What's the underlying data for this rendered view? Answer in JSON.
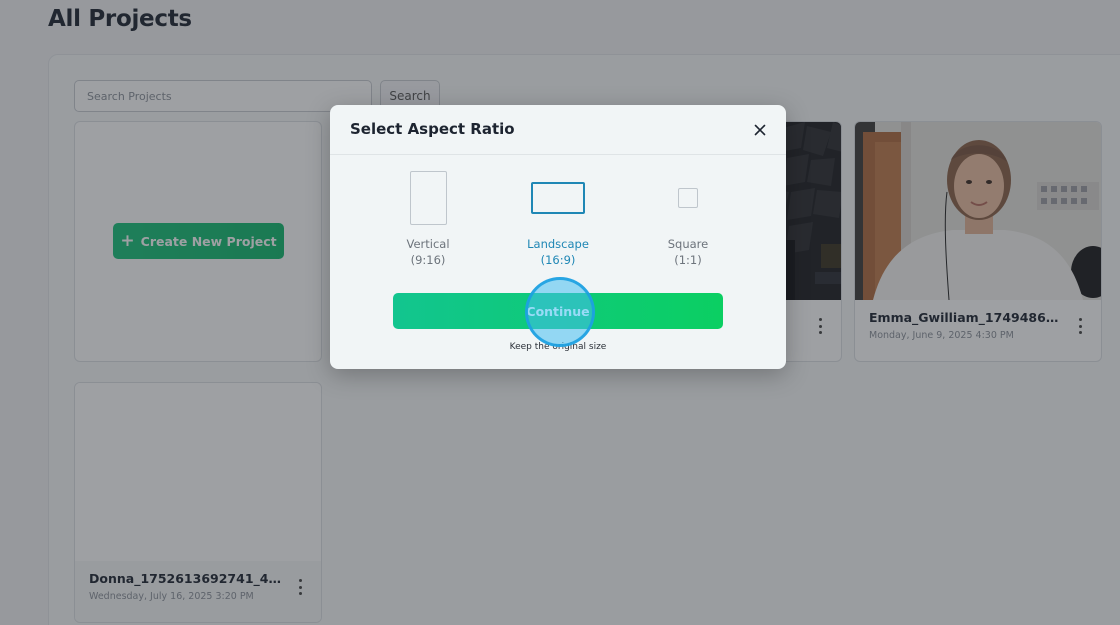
{
  "page": {
    "title": "All Projects"
  },
  "search": {
    "placeholder": "Search Projects",
    "value": "",
    "button_label": "Search"
  },
  "create": {
    "label": "Create New Project",
    "icon": "plus-icon"
  },
  "projects": [
    {
      "title": "Emma_Gwilliam_17494860327...",
      "date": "Monday, June 9, 2025 4:30 PM"
    },
    {
      "title": "Donna_1752613692741_43ebcb...",
      "date": "Wednesday, July 16, 2025 3:20 PM"
    }
  ],
  "modal": {
    "title": "Select Aspect Ratio",
    "options": [
      {
        "name": "Vertical",
        "ratio": "(9:16)",
        "selected": false
      },
      {
        "name": "Landscape",
        "ratio": "(16:9)",
        "selected": true
      },
      {
        "name": "Square",
        "ratio": "(1:1)",
        "selected": false
      }
    ],
    "continue_label": "Continue",
    "continue_note": "Keep the original size"
  },
  "colors": {
    "accent_green": "#10b96c",
    "selected_blue": "#1f87b5",
    "click_indicator": "#45bef0"
  }
}
